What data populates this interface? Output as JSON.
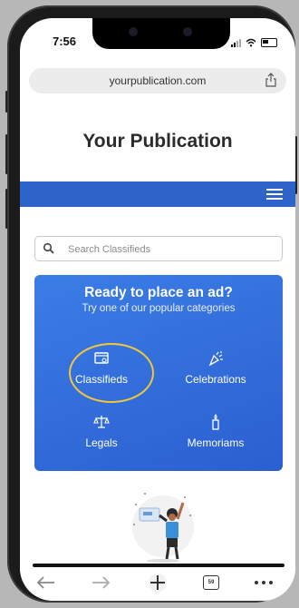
{
  "status_bar": {
    "time": "7:56"
  },
  "browser": {
    "url": "yourpublication.com",
    "tab_count": "59"
  },
  "site": {
    "title": "Your Publication"
  },
  "search": {
    "placeholder": "Search Classifieds",
    "value": ""
  },
  "ad_panel": {
    "title": "Ready to place an ad?",
    "subtitle": "Try one of our popular categories",
    "categories": [
      {
        "label": "Classifieds",
        "icon": "browser-window-icon"
      },
      {
        "label": "Celebrations",
        "icon": "party-popper-icon"
      },
      {
        "label": "Legals",
        "icon": "scales-icon"
      },
      {
        "label": "Memoriams",
        "icon": "candle-icon"
      }
    ]
  },
  "colors": {
    "nav_bar": "#2e63c9",
    "panel": "#3b7de6",
    "highlight": "#f0c63d"
  }
}
